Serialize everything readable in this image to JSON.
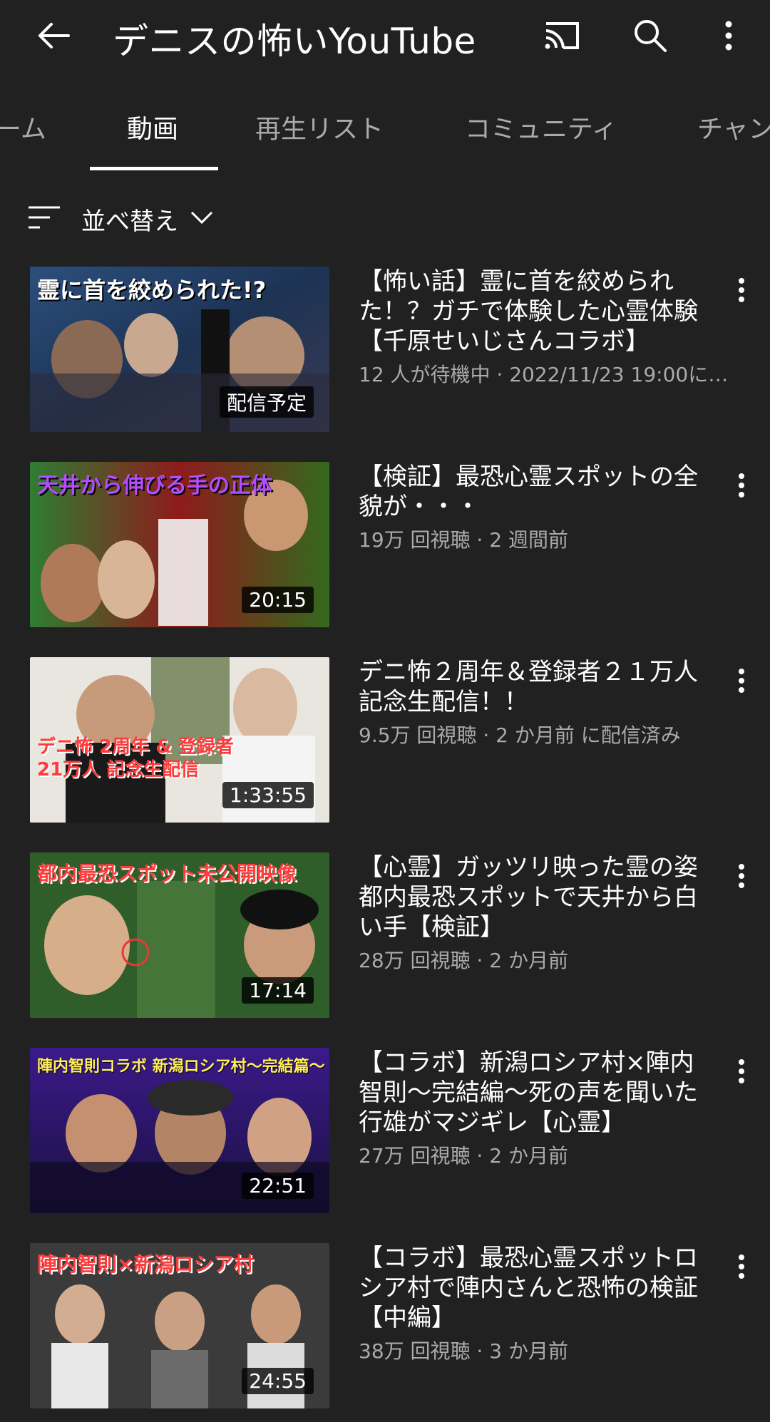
{
  "header": {
    "title": "デニスの怖いYouTube",
    "back_icon": "arrow-left-icon",
    "cast_icon": "cast-icon",
    "search_icon": "search-icon",
    "more_icon": "more-vert-icon"
  },
  "tabs": [
    {
      "label": "ーム"
    },
    {
      "label": "動画",
      "active": true
    },
    {
      "label": "再生リスト"
    },
    {
      "label": "コミュニティ"
    },
    {
      "label": "チャン"
    }
  ],
  "sort": {
    "label": "並べ替え"
  },
  "videos": [
    {
      "title": "【怖い話】霊に首を絞められた！？ガチで体験した心霊体験【千原せいじさんコラボ】",
      "meta": "12 人が待機中 · 2022/11/23 19:00に…",
      "badge": "配信予定",
      "thumb_text": "霊に首を絞められた!?"
    },
    {
      "title": "【検証】最恐心霊スポットの全貌が・・・",
      "meta": "19万 回視聴 · 2 週間前",
      "badge": "20:15",
      "thumb_text": "天井から伸びる手の正体"
    },
    {
      "title": "デニ怖２周年＆登録者２１万人記念生配信！！",
      "meta": "9.5万 回視聴 · 2 か月前 に配信済み",
      "badge": "1:33:55",
      "thumb_text": "デニ怖 2周年 & 登録者21万人 記念生配信"
    },
    {
      "title": "【心霊】ガッツリ映った霊の姿　都内最恐スポットで天井から白い手【検証】",
      "meta": "28万 回視聴 · 2 か月前",
      "badge": "17:14",
      "thumb_text": "都内最恐スポット未公開映像"
    },
    {
      "title": "【コラボ】新潟ロシア村×陣内智則〜完結編〜死の声を聞いた行雄がマジギレ【心霊】",
      "meta": "27万 回視聴 · 2 か月前",
      "badge": "22:51",
      "thumb_text": "陣内智則コラボ 新潟ロシア村〜完結篇〜"
    },
    {
      "title": "【コラボ】最恐心霊スポットロシア村で陣内さんと恐怖の検証【中編】",
      "meta": "38万 回視聴 · 3 か月前",
      "badge": "24:55",
      "thumb_text": "陣内智則×新潟ロシア村"
    }
  ]
}
